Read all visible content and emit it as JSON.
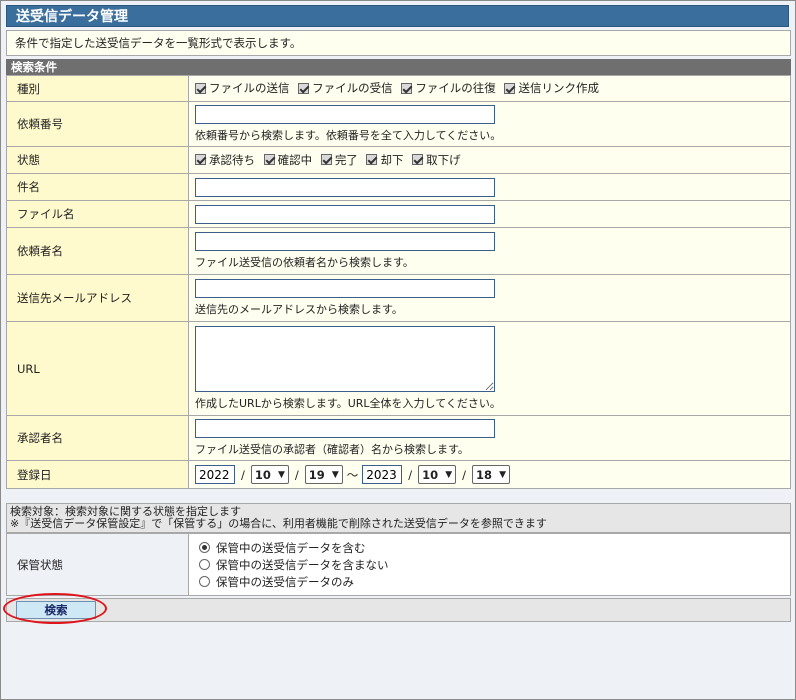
{
  "title": "送受信データ管理",
  "description": "条件で指定した送受信データを一覧形式で表示します。",
  "section_title": "検索条件",
  "type": {
    "label": "種別",
    "options": [
      "ファイルの送信",
      "ファイルの受信",
      "ファイルの往復",
      "送信リンク作成"
    ]
  },
  "request_no": {
    "label": "依頼番号",
    "value": "",
    "hint": "依頼番号から検索します。依頼番号を全て入力してください。"
  },
  "status": {
    "label": "状態",
    "options": [
      "承認待ち",
      "確認中",
      "完了",
      "却下",
      "取下げ"
    ]
  },
  "subject": {
    "label": "件名",
    "value": ""
  },
  "filename": {
    "label": "ファイル名",
    "value": ""
  },
  "requester": {
    "label": "依頼者名",
    "value": "",
    "hint": "ファイル送受信の依頼者名から検索します。"
  },
  "recipient_email": {
    "label": "送信先メールアドレス",
    "value": "",
    "hint": "送信先のメールアドレスから検索します。"
  },
  "url": {
    "label": "URL",
    "value": "",
    "hint": "作成したURLから検索します。URL全体を入力してください。"
  },
  "approver": {
    "label": "承認者名",
    "value": "",
    "hint": "ファイル送受信の承認者（確認者）名から検索します。"
  },
  "registered": {
    "label": "登録日",
    "from_year": "2022",
    "from_month": "10",
    "from_day": "19",
    "to_year": "2023",
    "to_month": "10",
    "to_day": "18",
    "slash": "/",
    "tilde": "～"
  },
  "note": {
    "line1": "検索対象：検索対象に関する状態を指定します",
    "line2": "※『送受信データ保管設定』で「保管する」の場合に、利用者機能で削除された送受信データを参照できます"
  },
  "storage": {
    "label": "保管状態",
    "options": [
      "保管中の送受信データを含む",
      "保管中の送受信データを含まない",
      "保管中の送受信データのみ"
    ],
    "selected_index": 0
  },
  "search_button": "検索",
  "colors": {
    "title_bg": "#3a6e9c",
    "label_bg": "#fffacd",
    "highlight": "#e0141a"
  }
}
